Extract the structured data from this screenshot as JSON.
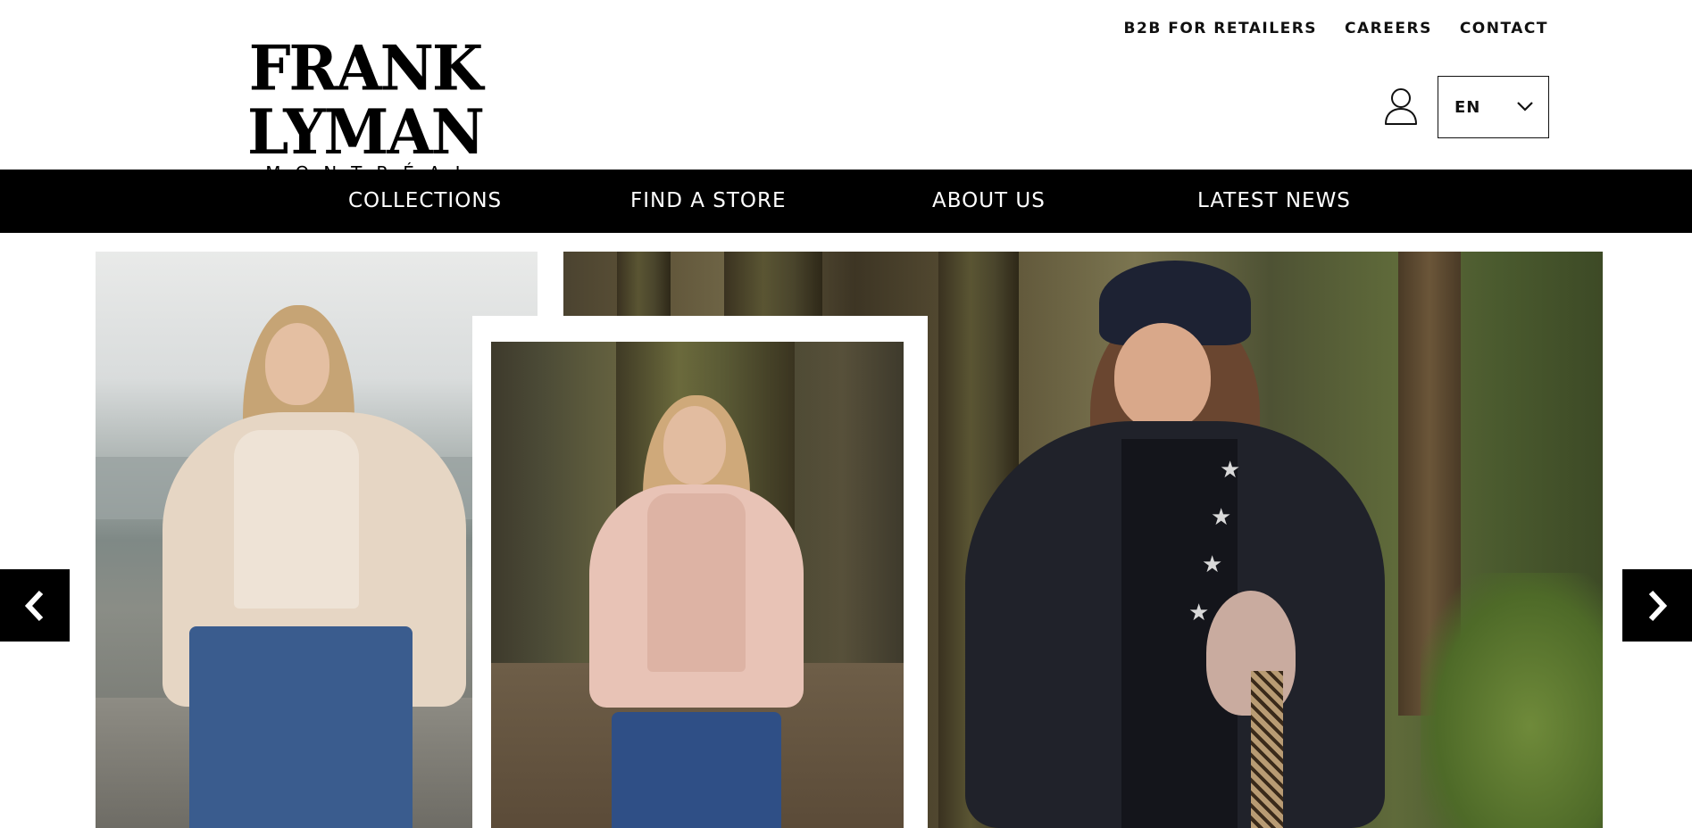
{
  "brand": {
    "name": "FRANK LYMAN",
    "city": "MONTRÉAL"
  },
  "utility_nav": {
    "b2b": "B2B FOR RETAILERS",
    "careers": "CAREERS",
    "contact": "CONTACT"
  },
  "account": {
    "icon": "user-icon"
  },
  "language": {
    "selected": "EN",
    "icon": "chevron-down-icon"
  },
  "main_nav": {
    "items": [
      {
        "label": "COLLECTIONS"
      },
      {
        "label": "FIND A STORE"
      },
      {
        "label": "ABOUT US"
      },
      {
        "label": "LATEST NEWS"
      }
    ]
  },
  "hero": {
    "prev_icon": "chevron-left-icon",
    "next_icon": "chevron-right-icon"
  },
  "colors": {
    "nav_background": "#000000",
    "nav_text": "#ffffff",
    "page_background": "#ffffff",
    "text": "#111111"
  }
}
